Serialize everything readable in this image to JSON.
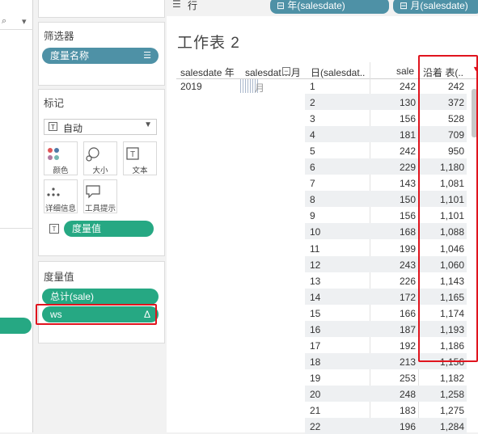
{
  "left_pane": {
    "search_hint": "⌕",
    "dropdown_arrow": "▾"
  },
  "shelves": {
    "rows_label": "行",
    "pills": [
      "⊟ 年(salesdate)",
      "⊟ 月(salesdate)"
    ]
  },
  "filters": {
    "title": "筛选器",
    "pill": "度量名称"
  },
  "marks": {
    "title": "标记",
    "type_label": "自动",
    "buttons": [
      "颜色",
      "大小",
      "文本",
      "详细信息",
      "工具提示"
    ],
    "text_pill": "度量值"
  },
  "measure_values": {
    "title": "度量值",
    "pills": [
      "总计(sale)",
      "ws"
    ],
    "delta_icon": "Δ"
  },
  "sheet": {
    "title": "工作表 2",
    "headers": {
      "year": "salesdate 年",
      "month": "salesdat…月",
      "day": "日(salesdat..",
      "sale": "sale",
      "ws": "沿着 表(.."
    },
    "year_value": "2019",
    "month_value": "月",
    "rows": [
      {
        "day": "1",
        "sale": "242",
        "ws": "242"
      },
      {
        "day": "2",
        "sale": "130",
        "ws": "372"
      },
      {
        "day": "3",
        "sale": "156",
        "ws": "528"
      },
      {
        "day": "4",
        "sale": "181",
        "ws": "709"
      },
      {
        "day": "5",
        "sale": "242",
        "ws": "950"
      },
      {
        "day": "6",
        "sale": "229",
        "ws": "1,180"
      },
      {
        "day": "7",
        "sale": "143",
        "ws": "1,081"
      },
      {
        "day": "8",
        "sale": "150",
        "ws": "1,101"
      },
      {
        "day": "9",
        "sale": "156",
        "ws": "1,101"
      },
      {
        "day": "10",
        "sale": "168",
        "ws": "1,088"
      },
      {
        "day": "11",
        "sale": "199",
        "ws": "1,046"
      },
      {
        "day": "12",
        "sale": "243",
        "ws": "1,060"
      },
      {
        "day": "13",
        "sale": "226",
        "ws": "1,143"
      },
      {
        "day": "14",
        "sale": "172",
        "ws": "1,165"
      },
      {
        "day": "15",
        "sale": "166",
        "ws": "1,174"
      },
      {
        "day": "16",
        "sale": "187",
        "ws": "1,193"
      },
      {
        "day": "17",
        "sale": "192",
        "ws": "1,186"
      },
      {
        "day": "18",
        "sale": "213",
        "ws": "1,156"
      },
      {
        "day": "19",
        "sale": "253",
        "ws": "1,182"
      },
      {
        "day": "20",
        "sale": "248",
        "ws": "1,258"
      },
      {
        "day": "21",
        "sale": "183",
        "ws": "1,275"
      },
      {
        "day": "22",
        "sale": "196",
        "ws": "1,284"
      }
    ]
  },
  "colors": {
    "pill_blue": "#4e91a6",
    "pill_green": "#26a883",
    "highlight_red": "#e0141e"
  }
}
